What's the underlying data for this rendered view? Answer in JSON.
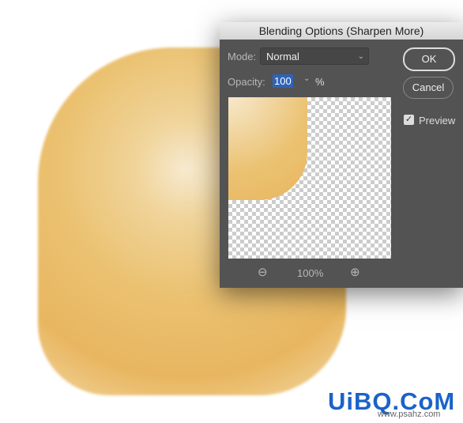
{
  "dialog": {
    "title": "Blending Options (Sharpen More)",
    "mode_label": "Mode:",
    "mode_value": "Normal",
    "opacity_label": "Opacity:",
    "opacity_value": "100",
    "opacity_unit": "%",
    "ok": "OK",
    "cancel": "Cancel",
    "preview_label": "Preview",
    "preview_checked": true,
    "zoom_level": "100%"
  },
  "watermark": {
    "logo": "UiBQ.CoM",
    "url": "www.psahz.com"
  }
}
